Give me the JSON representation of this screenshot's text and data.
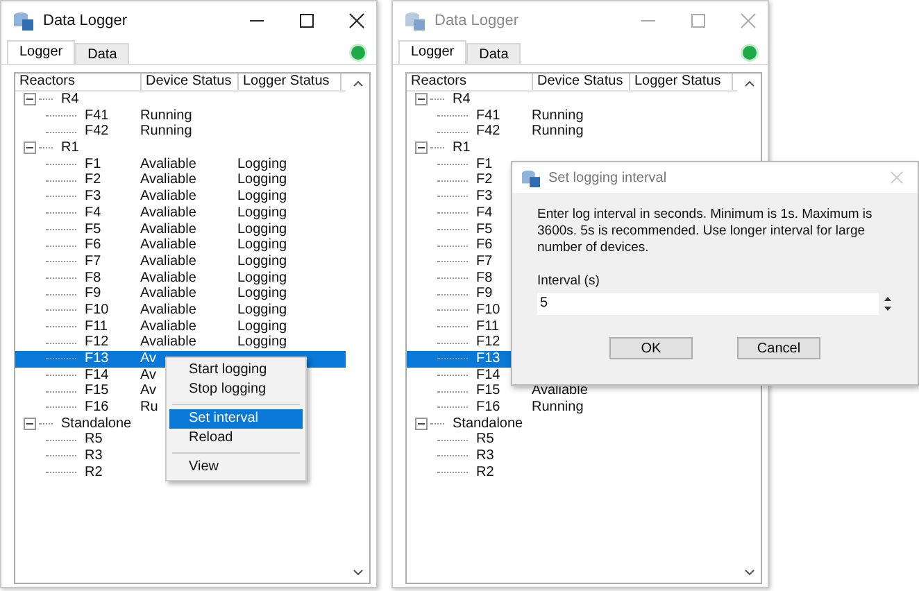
{
  "windows": [
    {
      "title": "Data Logger",
      "active": true,
      "tabs": [
        {
          "label": "Logger",
          "selected": true
        },
        {
          "label": "Data",
          "selected": false
        }
      ],
      "connected": true,
      "columns": [
        "Reactors",
        "Device Status",
        "Logger Status"
      ],
      "tree": [
        {
          "name": "R4",
          "expanded": true,
          "children": [
            {
              "name": "F41",
              "device_status": "Running",
              "selected": false
            },
            {
              "name": "F42",
              "device_status": "Running",
              "selected": false
            }
          ]
        },
        {
          "name": "R1",
          "expanded": true,
          "children": [
            {
              "name": "F1",
              "device_status": "Avaliable",
              "logger_status": "Logging",
              "selected": false
            },
            {
              "name": "F2",
              "device_status": "Avaliable",
              "logger_status": "Logging",
              "selected": false
            },
            {
              "name": "F3",
              "device_status": "Avaliable",
              "logger_status": "Logging",
              "selected": false
            },
            {
              "name": "F4",
              "device_status": "Avaliable",
              "logger_status": "Logging",
              "selected": false
            },
            {
              "name": "F5",
              "device_status": "Avaliable",
              "logger_status": "Logging",
              "selected": false
            },
            {
              "name": "F6",
              "device_status": "Avaliable",
              "logger_status": "Logging",
              "selected": false
            },
            {
              "name": "F7",
              "device_status": "Avaliable",
              "logger_status": "Logging",
              "selected": false
            },
            {
              "name": "F8",
              "device_status": "Avaliable",
              "logger_status": "Logging",
              "selected": false
            },
            {
              "name": "F9",
              "device_status": "Avaliable",
              "logger_status": "Logging",
              "selected": false
            },
            {
              "name": "F10",
              "device_status": "Avaliable",
              "logger_status": "Logging",
              "selected": false
            },
            {
              "name": "F11",
              "device_status": "Avaliable",
              "logger_status": "Logging",
              "selected": false
            },
            {
              "name": "F12",
              "device_status": "Avaliable",
              "logger_status": "Logging",
              "selected": false
            },
            {
              "name": "F13",
              "device_status": "Av",
              "selected": true
            },
            {
              "name": "F14",
              "device_status": "Av",
              "selected": false
            },
            {
              "name": "F15",
              "device_status": "Av",
              "selected": false
            },
            {
              "name": "F16",
              "device_status": "Ru",
              "selected": false
            }
          ]
        },
        {
          "name": "Standalone",
          "expanded": true,
          "children": [
            {
              "name": "R5",
              "selected": false
            },
            {
              "name": "R3",
              "selected": false
            },
            {
              "name": "R2",
              "selected": false
            }
          ]
        }
      ],
      "context_menu": {
        "items": [
          {
            "kind": "item",
            "label": "Start logging",
            "selected": false
          },
          {
            "kind": "item",
            "label": "Stop logging",
            "selected": false
          },
          {
            "kind": "separator"
          },
          {
            "kind": "item",
            "label": "Set interval",
            "selected": true
          },
          {
            "kind": "item",
            "label": "Reload",
            "selected": false
          },
          {
            "kind": "separator"
          },
          {
            "kind": "item",
            "label": "View",
            "selected": false
          }
        ]
      }
    },
    {
      "title": "Data Logger",
      "active": false,
      "tabs": [
        {
          "label": "Logger",
          "selected": true
        },
        {
          "label": "Data",
          "selected": false
        }
      ],
      "connected": true,
      "columns": [
        "Reactors",
        "Device Status",
        "Logger Status"
      ],
      "tree": [
        {
          "name": "R4",
          "expanded": true,
          "children": [
            {
              "name": "F41",
              "device_status": "Running",
              "selected": false
            },
            {
              "name": "F42",
              "device_status": "Running",
              "selected": false
            }
          ]
        },
        {
          "name": "R1",
          "expanded": true,
          "children": [
            {
              "name": "F1",
              "selected": false
            },
            {
              "name": "F2",
              "selected": false
            },
            {
              "name": "F3",
              "selected": false
            },
            {
              "name": "F4",
              "selected": false
            },
            {
              "name": "F5",
              "selected": false
            },
            {
              "name": "F6",
              "selected": false
            },
            {
              "name": "F7",
              "selected": false
            },
            {
              "name": "F8",
              "selected": false
            },
            {
              "name": "F9",
              "selected": false
            },
            {
              "name": "F10",
              "selected": false
            },
            {
              "name": "F11",
              "selected": false
            },
            {
              "name": "F12",
              "selected": false
            },
            {
              "name": "F13",
              "selected": true
            },
            {
              "name": "F14",
              "selected": false
            },
            {
              "name": "F15",
              "device_status": "Avaliable",
              "selected": false
            },
            {
              "name": "F16",
              "device_status": "Running",
              "selected": false
            }
          ]
        },
        {
          "name": "Standalone",
          "expanded": true,
          "children": [
            {
              "name": "R5",
              "selected": false
            },
            {
              "name": "R3",
              "selected": false
            },
            {
              "name": "R2",
              "selected": false
            }
          ]
        }
      ],
      "dialog": {
        "title": "Set logging interval",
        "message": "Enter log interval in seconds. Minimum is 1s. Maximum is 3600s. 5s is recommended. Use longer interval for large number of devices.",
        "field_label": "Interval (s)",
        "value": "5",
        "buttons": [
          "OK",
          "Cancel"
        ]
      }
    }
  ]
}
